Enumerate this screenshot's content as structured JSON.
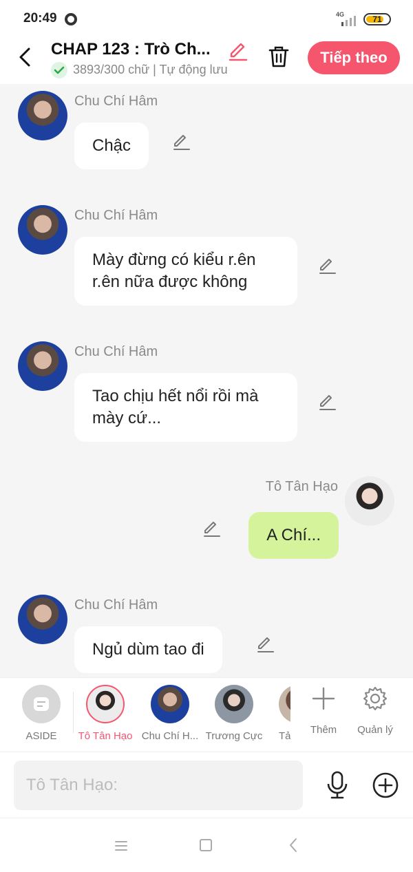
{
  "status_bar": {
    "time": "20:49",
    "network": "4G",
    "battery": "71"
  },
  "header": {
    "title": "CHAP 123 : Trò Ch...",
    "word_count": "3893/300 chữ | Tự động lưu",
    "next_label": "Tiếp theo"
  },
  "messages": [
    {
      "sender": "Chu Chí Hâm",
      "text": "Chậc",
      "mine": false
    },
    {
      "sender": "Chu Chí Hâm",
      "text": "Mày đừng có kiểu r.ên r.ên nữa được không",
      "mine": false
    },
    {
      "sender": "Chu Chí Hâm",
      "text": "Tao chịu hết nổi rồi mà mày cứ...",
      "mine": false
    },
    {
      "sender": "Tô Tân Hạo",
      "text": "A Chí...",
      "mine": true
    },
    {
      "sender": "Chu Chí Hâm",
      "text": "Ngủ dùm tao đi",
      "mine": false
    }
  ],
  "characters": [
    {
      "name": "ASIDE"
    },
    {
      "name": "Tô Tân Hạo"
    },
    {
      "name": "Chu Chí H..."
    },
    {
      "name": "Trương Cực"
    },
    {
      "name": "Tả"
    }
  ],
  "tools": {
    "add_label": "Thêm",
    "manage_label": "Quản lý"
  },
  "composer": {
    "placeholder": "Tô Tân Hạo:"
  }
}
